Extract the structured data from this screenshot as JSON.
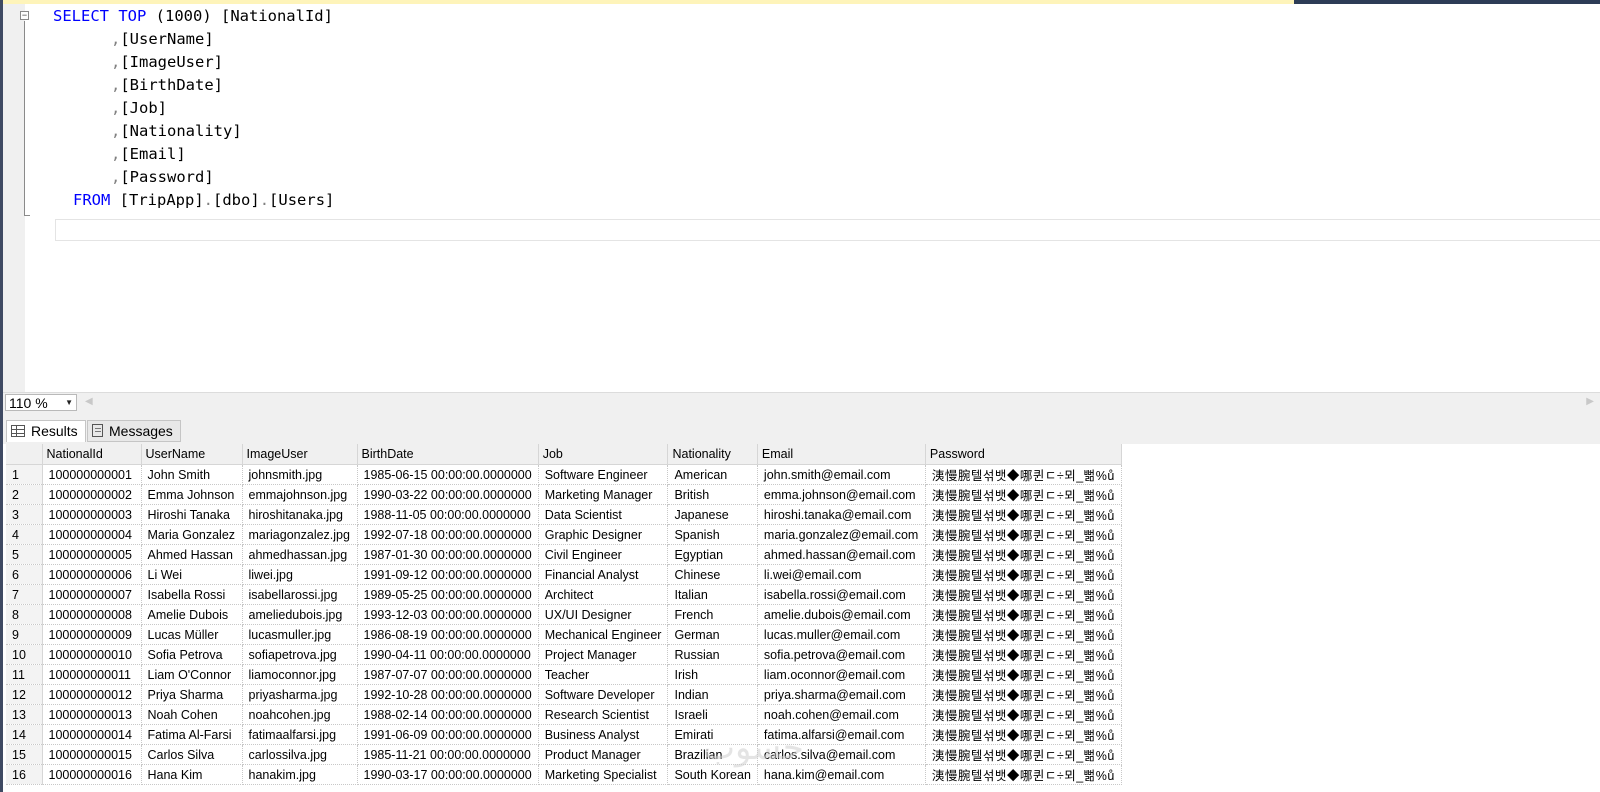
{
  "editor": {
    "lines": [
      {
        "kw": "SELECT TOP",
        "rest": " (1000) [NationalId]"
      },
      {
        "sep": ",",
        "col": "[UserName]"
      },
      {
        "sep": ",",
        "col": "[ImageUser]"
      },
      {
        "sep": ",",
        "col": "[BirthDate]"
      },
      {
        "sep": ",",
        "col": "[Job]"
      },
      {
        "sep": ",",
        "col": "[Nationality]"
      },
      {
        "sep": ",",
        "col": "[Email]"
      },
      {
        "sep": ",",
        "col": "[Password]"
      }
    ],
    "from": {
      "kw": "FROM",
      "db": "[TripApp]",
      "dot": ".",
      "schema": "[dbo]",
      "table": "[Users]"
    }
  },
  "zoom": {
    "value": "110 %"
  },
  "tabs": {
    "results": "Results",
    "messages": "Messages"
  },
  "grid": {
    "headers": [
      "NationalId",
      "UserName",
      "ImageUser",
      "BirthDate",
      "Job",
      "Nationality",
      "Email",
      "Password"
    ],
    "rows": [
      [
        "1",
        "100000000001",
        "John Smith",
        "johnsmith.jpg",
        "1985-06-15 00:00:00.0000000",
        "Software Engineer",
        "American",
        "john.smith@email.com",
        "洟慢腕텔섞뱃◆哪퀸ㄷ÷뫼_뻚%ů"
      ],
      [
        "2",
        "100000000002",
        "Emma Johnson",
        "emmajohnson.jpg",
        "1990-03-22 00:00:00.0000000",
        "Marketing Manager",
        "British",
        "emma.johnson@email.com",
        "洟慢腕텔섞뱃◆哪퀸ㄷ÷뫼_뻚%ů"
      ],
      [
        "3",
        "100000000003",
        "Hiroshi Tanaka",
        "hiroshitanaka.jpg",
        "1988-11-05 00:00:00.0000000",
        "Data Scientist",
        "Japanese",
        "hiroshi.tanaka@email.com",
        "洟慢腕텔섞뱃◆哪퀸ㄷ÷뫼_뻚%ů"
      ],
      [
        "4",
        "100000000004",
        "Maria Gonzalez",
        "mariagonzalez.jpg",
        "1992-07-18 00:00:00.0000000",
        "Graphic Designer",
        "Spanish",
        "maria.gonzalez@email.com",
        "洟慢腕텔섞뱃◆哪퀸ㄷ÷뫼_뻚%ů"
      ],
      [
        "5",
        "100000000005",
        "Ahmed Hassan",
        "ahmedhassan.jpg",
        "1987-01-30 00:00:00.0000000",
        "Civil Engineer",
        "Egyptian",
        "ahmed.hassan@email.com",
        "洟慢腕텔섞뱃◆哪퀸ㄷ÷뫼_뻚%ů"
      ],
      [
        "6",
        "100000000006",
        "Li Wei",
        "liwei.jpg",
        "1991-09-12 00:00:00.0000000",
        "Financial Analyst",
        "Chinese",
        "li.wei@email.com",
        "洟慢腕텔섞뱃◆哪퀸ㄷ÷뫼_뻚%ů"
      ],
      [
        "7",
        "100000000007",
        "Isabella Rossi",
        "isabellarossi.jpg",
        "1989-05-25 00:00:00.0000000",
        "Architect",
        "Italian",
        "isabella.rossi@email.com",
        "洟慢腕텔섞뱃◆哪퀸ㄷ÷뫼_뻚%ů"
      ],
      [
        "8",
        "100000000008",
        "Amelie Dubois",
        "ameliedubois.jpg",
        "1993-12-03 00:00:00.0000000",
        "UX/UI Designer",
        "French",
        "amelie.dubois@email.com",
        "洟慢腕텔섞뱃◆哪퀸ㄷ÷뫼_뻚%ů"
      ],
      [
        "9",
        "100000000009",
        "Lucas Müller",
        "lucasmuller.jpg",
        "1986-08-19 00:00:00.0000000",
        "Mechanical Engineer",
        "German",
        "lucas.muller@email.com",
        "洟慢腕텔섞뱃◆哪퀸ㄷ÷뫼_뻚%ů"
      ],
      [
        "10",
        "100000000010",
        "Sofia Petrova",
        "sofiapetrova.jpg",
        "1990-04-11 00:00:00.0000000",
        "Project Manager",
        "Russian",
        "sofia.petrova@email.com",
        "洟慢腕텔섞뱃◆哪퀸ㄷ÷뫼_뻚%ů"
      ],
      [
        "11",
        "100000000011",
        "Liam O'Connor",
        "liamoconnor.jpg",
        "1987-07-07 00:00:00.0000000",
        "Teacher",
        "Irish",
        "liam.oconnor@email.com",
        "洟慢腕텔섞뱃◆哪퀸ㄷ÷뫼_뻚%ů"
      ],
      [
        "12",
        "100000000012",
        "Priya Sharma",
        "priyasharma.jpg",
        "1992-10-28 00:00:00.0000000",
        "Software Developer",
        "Indian",
        "priya.sharma@email.com",
        "洟慢腕텔섞뱃◆哪퀸ㄷ÷뫼_뻚%ů"
      ],
      [
        "13",
        "100000000013",
        "Noah Cohen",
        "noahcohen.jpg",
        "1988-02-14 00:00:00.0000000",
        "Research Scientist",
        "Israeli",
        "noah.cohen@email.com",
        "洟慢腕텔섞뱃◆哪퀸ㄷ÷뫼_뻚%ů"
      ],
      [
        "14",
        "100000000014",
        "Fatima Al-Farsi",
        "fatimaalfarsi.jpg",
        "1991-06-09 00:00:00.0000000",
        "Business Analyst",
        "Emirati",
        "fatima.alfarsi@email.com",
        "洟慢腕텔섞뱃◆哪퀸ㄷ÷뫼_뻚%ů"
      ],
      [
        "15",
        "100000000015",
        "Carlos Silva",
        "carlossilva.jpg",
        "1985-11-21 00:00:00.0000000",
        "Product Manager",
        "Brazilian",
        "carlos.silva@email.com",
        "洟慢腕텔섞뱃◆哪퀸ㄷ÷뫼_뻚%ů"
      ],
      [
        "16",
        "100000000016",
        "Hana Kim",
        "hanakim.jpg",
        "1990-03-17 00:00:00.0000000",
        "Marketing Specialist",
        "South Korean",
        "hana.kim@email.com",
        "洟慢腕텔섞뱃◆哪퀸ㄷ÷뫼_뻚%ů"
      ]
    ]
  },
  "colors": {
    "keyword": "#0000ff",
    "punctuation": "#808080",
    "frame": "#3f4a63"
  },
  "icons": {
    "results_tab": "grid-icon",
    "messages_tab": "message-icon",
    "zoom_dropdown": "chevron-down-icon"
  }
}
